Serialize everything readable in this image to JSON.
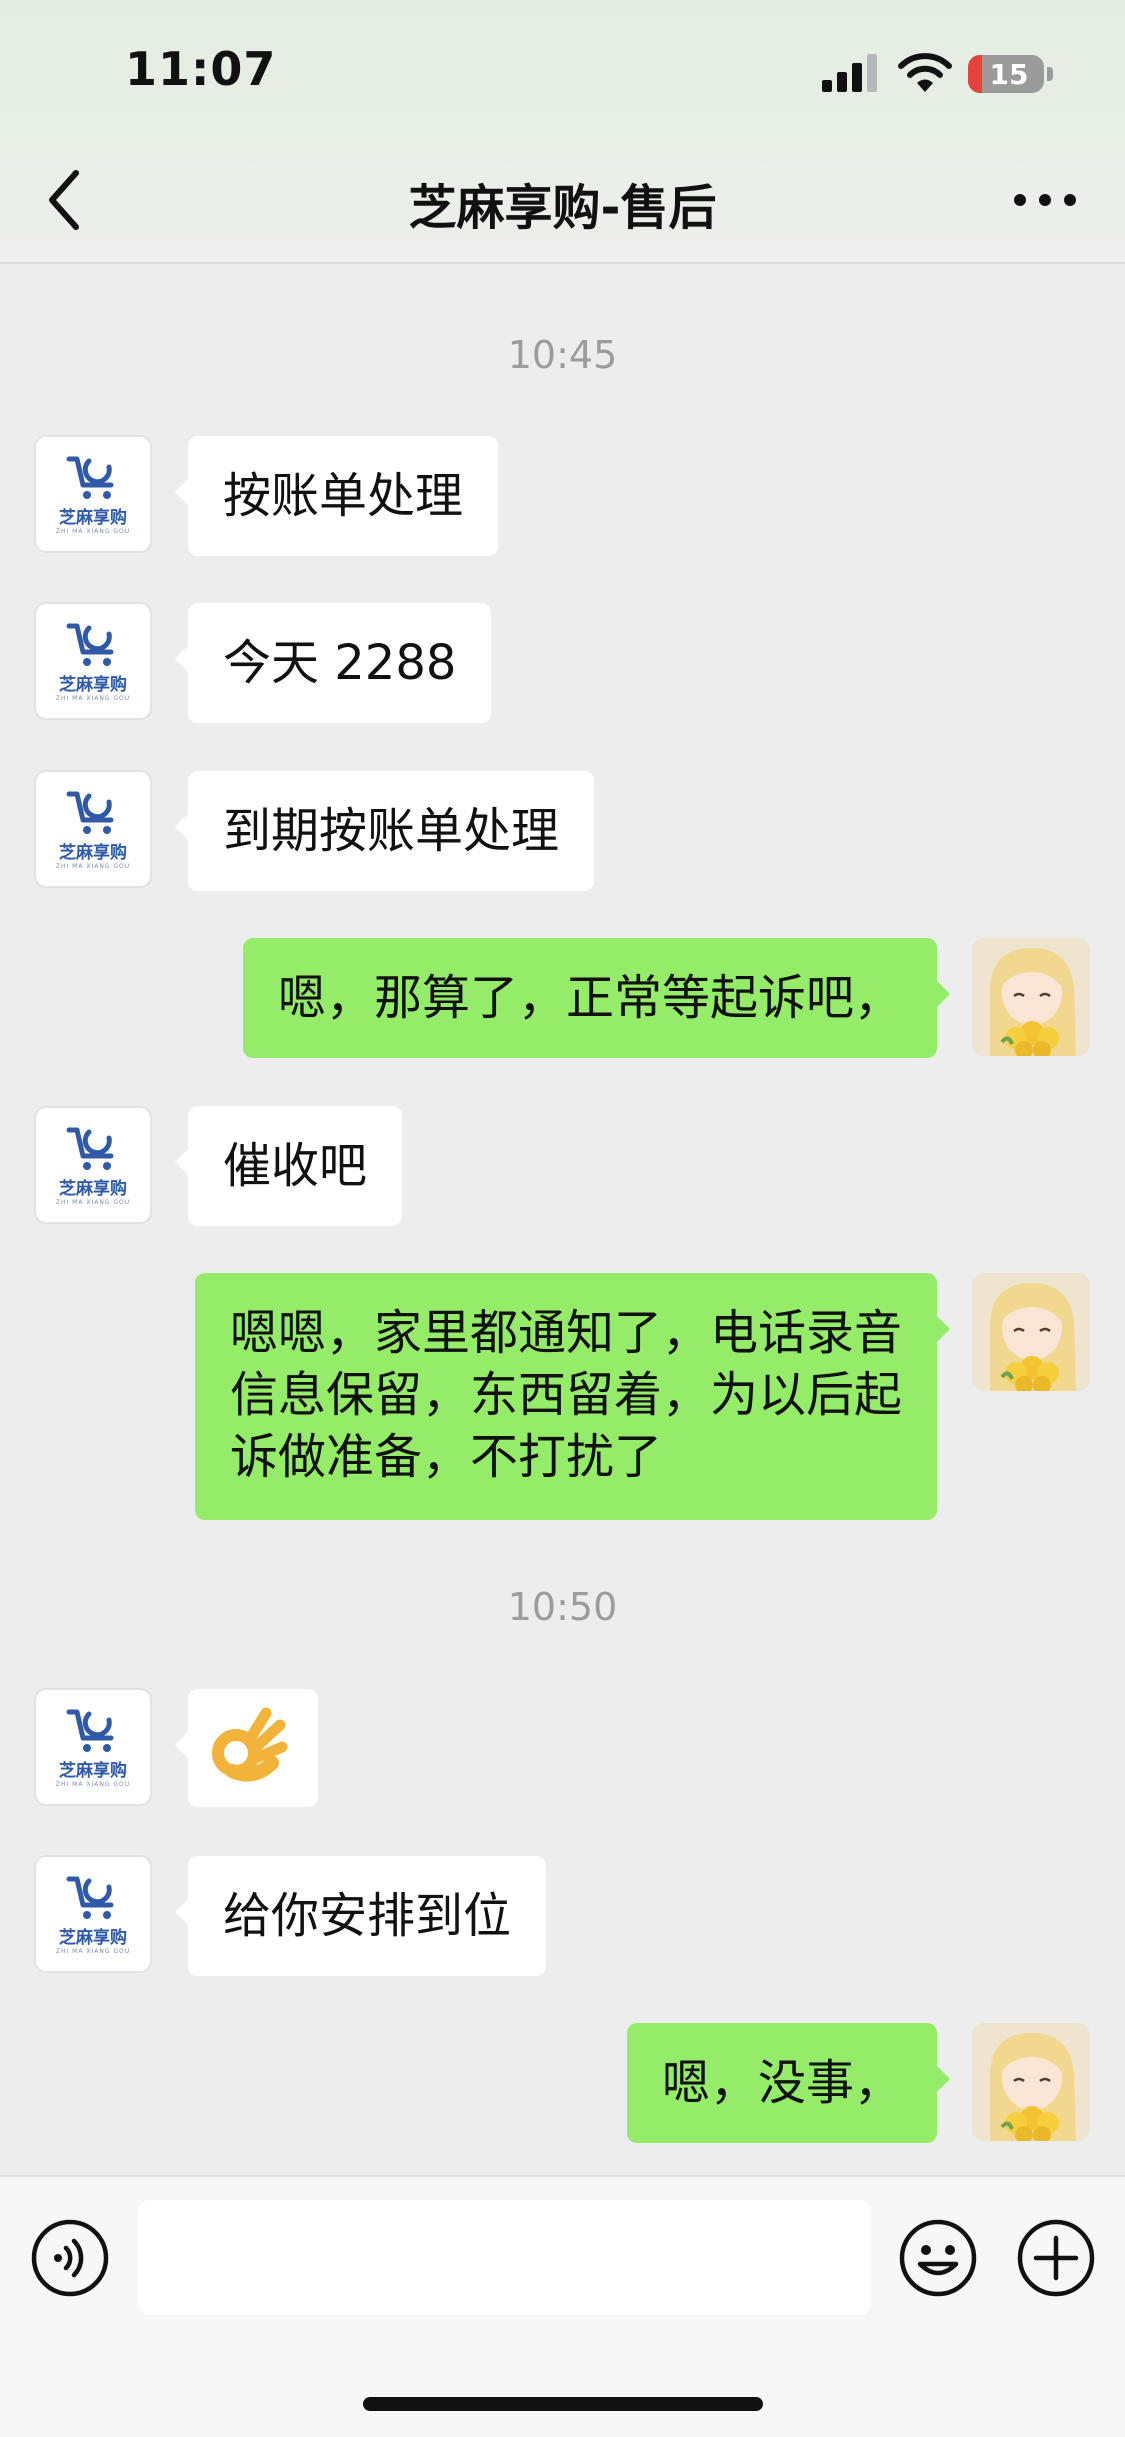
{
  "status_bar": {
    "time": "11:07",
    "battery": "15"
  },
  "header": {
    "title": "芝麻享购-售后"
  },
  "contact_logo": {
    "name": "芝麻享购",
    "sub": "ZHI MA XIANG GOU"
  },
  "timestamps": [
    "10:45",
    "10:50"
  ],
  "messages": [
    {
      "side": "in",
      "text": "按账单处理"
    },
    {
      "side": "in",
      "text": "今天 2288"
    },
    {
      "side": "in",
      "text": "到期按账单处理"
    },
    {
      "side": "out",
      "text": "嗯，那算了，正常等起诉吧，"
    },
    {
      "side": "in",
      "text": "催收吧"
    },
    {
      "side": "out",
      "lines": [
        "嗯嗯，家里都通知了，电话录音",
        "信息保留，东西留着，为以后起",
        "诉做准备，不打扰了"
      ]
    },
    {
      "side": "in",
      "emoji": "ok-hand-icon"
    },
    {
      "side": "in",
      "text": "给你安排到位"
    },
    {
      "side": "out",
      "text": "嗯，没事，"
    }
  ],
  "input": {
    "value": ""
  },
  "colors": {
    "sent_bubble": "#95ec69",
    "received_bubble": "#ffffff",
    "background": "#ededed"
  }
}
